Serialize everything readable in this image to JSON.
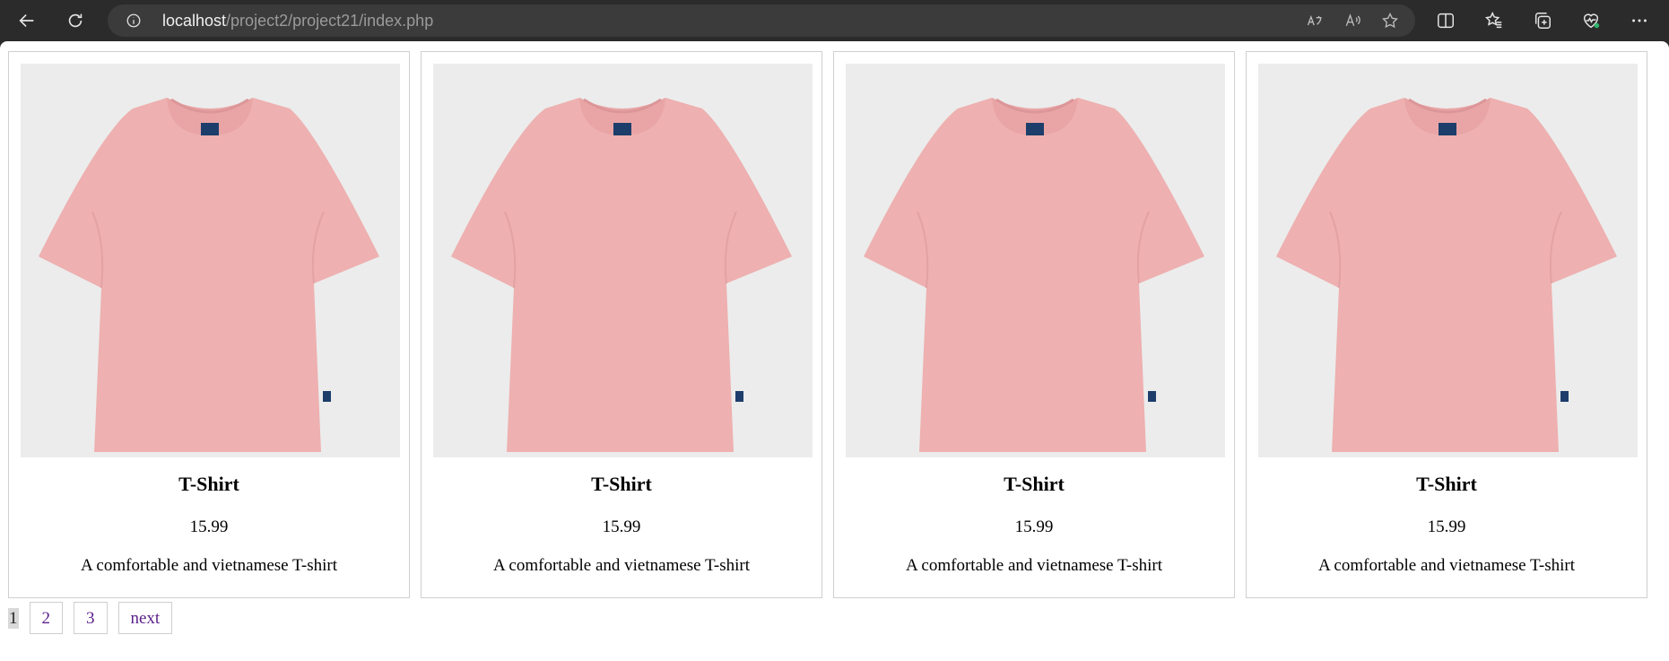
{
  "browser": {
    "url_host": "localhost",
    "url_path": "/project2/project21/index.php"
  },
  "products": [
    {
      "name": "T-Shirt",
      "price": "15.99",
      "description": "A comfortable and vietnamese T-shirt"
    },
    {
      "name": "T-Shirt",
      "price": "15.99",
      "description": "A comfortable and vietnamese T-shirt"
    },
    {
      "name": "T-Shirt",
      "price": "15.99",
      "description": "A comfortable and vietnamese T-shirt"
    },
    {
      "name": "T-Shirt",
      "price": "15.99",
      "description": "A comfortable and vietnamese T-shirt"
    }
  ],
  "pagination": {
    "current": "1",
    "pages": [
      "2",
      "3"
    ],
    "next_label": "next"
  },
  "colors": {
    "shirt": "#eeb0b0",
    "photo_bg": "#ececec",
    "link": "#5a1f8c"
  }
}
